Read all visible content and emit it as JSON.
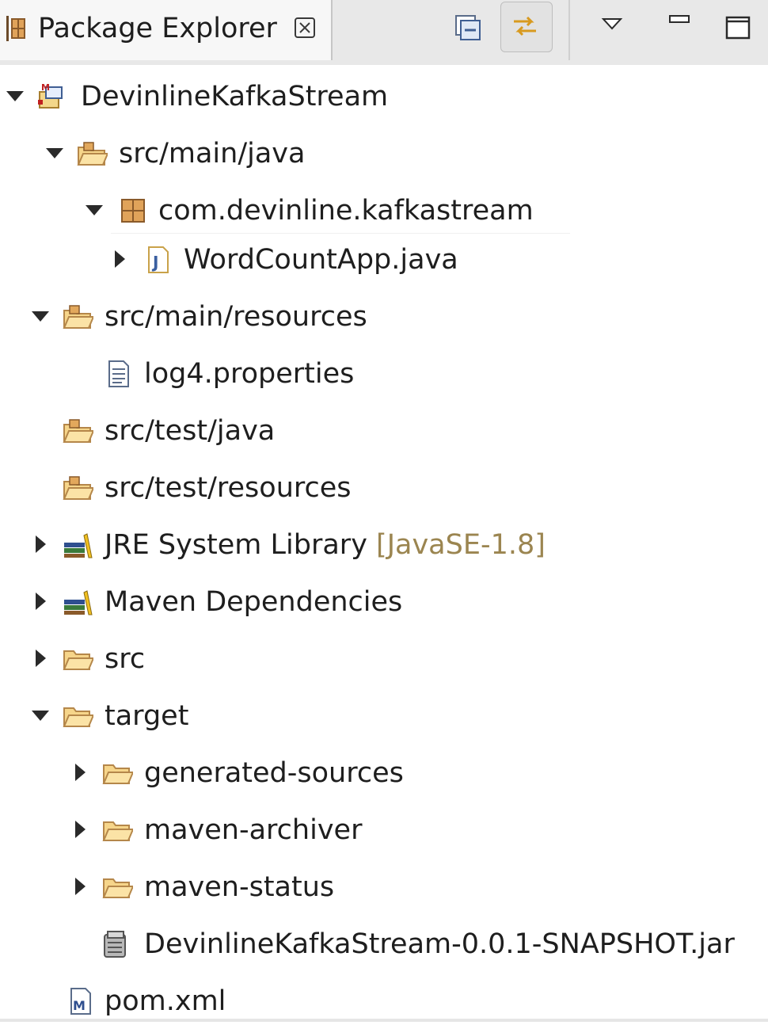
{
  "view": {
    "title": "Package Explorer",
    "toolbar": {
      "collapse_all": "collapse-all-icon",
      "link_with_editor": "link-with-editor-icon",
      "view_menu": "view-menu-icon",
      "minimize": "minimize-icon",
      "maximize": "maximize-icon"
    }
  },
  "tree": {
    "project": "DevinlineKafkaStream",
    "src_main_java": "src/main/java",
    "package": "com.devinline.kafkastream",
    "java_file": "WordCountApp.java",
    "src_main_resources": "src/main/resources",
    "properties_file": "log4.properties",
    "src_test_java": "src/test/java",
    "src_test_resources": "src/test/resources",
    "jre_library": "JRE System Library",
    "jre_version": "[JavaSE-1.8]",
    "maven_deps": "Maven Dependencies",
    "src_folder": "src",
    "target_folder": "target",
    "generated_sources": "generated-sources",
    "maven_archiver": "maven-archiver",
    "maven_status": "maven-status",
    "jar_file": "DevinlineKafkaStream-0.0.1-SNAPSHOT.jar",
    "pom": "pom.xml"
  },
  "colors": {
    "decoration": "#9b8550",
    "folder": "#f0c86a",
    "folder_stroke": "#b5874a"
  }
}
